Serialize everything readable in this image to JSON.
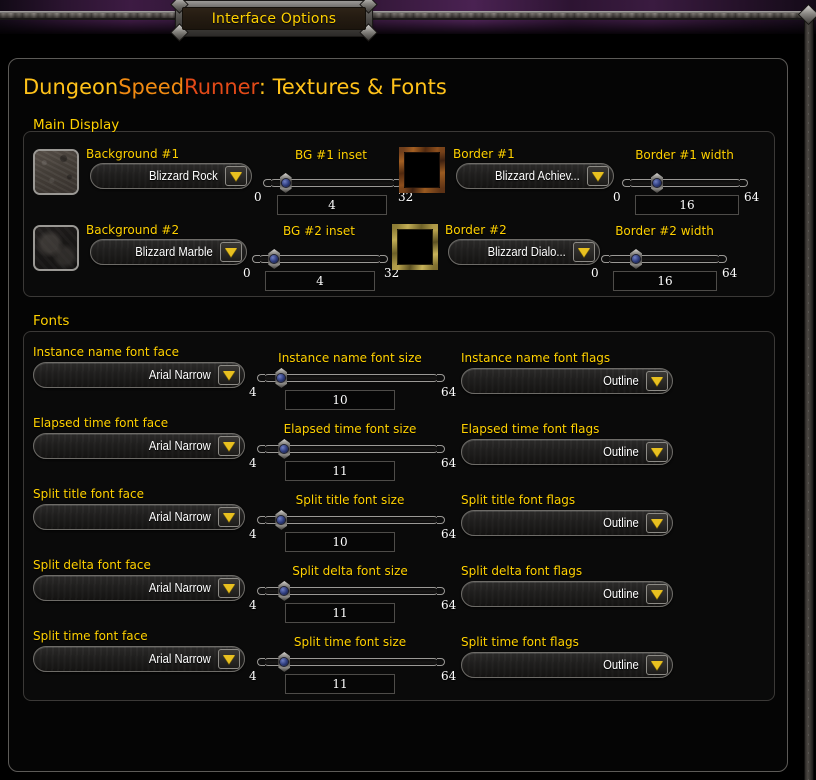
{
  "window": {
    "tab_label": "Interface Options"
  },
  "page": {
    "title_part1": "Dungeon",
    "title_part2": "Speed",
    "title_part3": "Runner",
    "title_part4": ": Textures & Fonts"
  },
  "main_display": {
    "group_label": "Main Display",
    "rows": [
      {
        "swatch": "rock-texture-preview",
        "face_label": "Background #1",
        "face_value": "Blizzard Rock",
        "slider_label": "BG #1 inset",
        "slider_min": "0",
        "slider_max": "32",
        "slider_value": "4",
        "percent": 12.5
      },
      {
        "swatch": "border-achievement-preview",
        "face_label": "Border #1",
        "face_value": "Blizzard Achiev...",
        "slider_label": "Border #1 width",
        "slider_min": "0",
        "slider_max": "64",
        "slider_value": "16",
        "percent": 25
      },
      {
        "swatch": "marble-texture-preview",
        "face_label": "Background #2",
        "face_value": "Blizzard Marble",
        "slider_label": "BG #2 inset",
        "slider_min": "0",
        "slider_max": "32",
        "slider_value": "4",
        "percent": 12.5
      },
      {
        "swatch": "border-dialog-preview",
        "face_label": "Border #2",
        "face_value": "Blizzard Dialo...",
        "slider_label": "Border #2 width",
        "slider_min": "0",
        "slider_max": "64",
        "slider_value": "16",
        "percent": 25
      }
    ]
  },
  "fonts": {
    "group_label": "Fonts",
    "rows": [
      {
        "face_label": "Instance name font face",
        "face_value": "Arial Narrow",
        "size_label": "Instance name font size",
        "size_min": "4",
        "size_max": "64",
        "size_value": "10",
        "percent": 10,
        "flags_label": "Instance name font flags",
        "flags_value": "Outline"
      },
      {
        "face_label": "Elapsed time font face",
        "face_value": "Arial Narrow",
        "size_label": "Elapsed time font size",
        "size_min": "4",
        "size_max": "64",
        "size_value": "11",
        "percent": 11.7,
        "flags_label": "Elapsed time font flags",
        "flags_value": "Outline"
      },
      {
        "face_label": "Split title font face",
        "face_value": "Arial Narrow",
        "size_label": "Split title font size",
        "size_min": "4",
        "size_max": "64",
        "size_value": "10",
        "percent": 10,
        "flags_label": "Split title font flags",
        "flags_value": "Outline"
      },
      {
        "face_label": "Split delta font face",
        "face_value": "Arial Narrow",
        "size_label": "Split delta font size",
        "size_min": "4",
        "size_max": "64",
        "size_value": "11",
        "percent": 11.7,
        "flags_label": "Split delta font flags",
        "flags_value": "Outline"
      },
      {
        "face_label": "Split time font face",
        "face_value": "Arial Narrow",
        "size_label": "Split time font size",
        "size_min": "4",
        "size_max": "64",
        "size_value": "11",
        "percent": 11.7,
        "flags_label": "Split time font flags",
        "flags_value": "Outline"
      }
    ]
  },
  "colors": {
    "gold": "#ffd100",
    "title_yellow": "#ffc21a",
    "title_orange": "#f08a12",
    "title_red": "#e34a18",
    "arrow_gold": "#e8c020",
    "panel_bg": "#050505"
  }
}
